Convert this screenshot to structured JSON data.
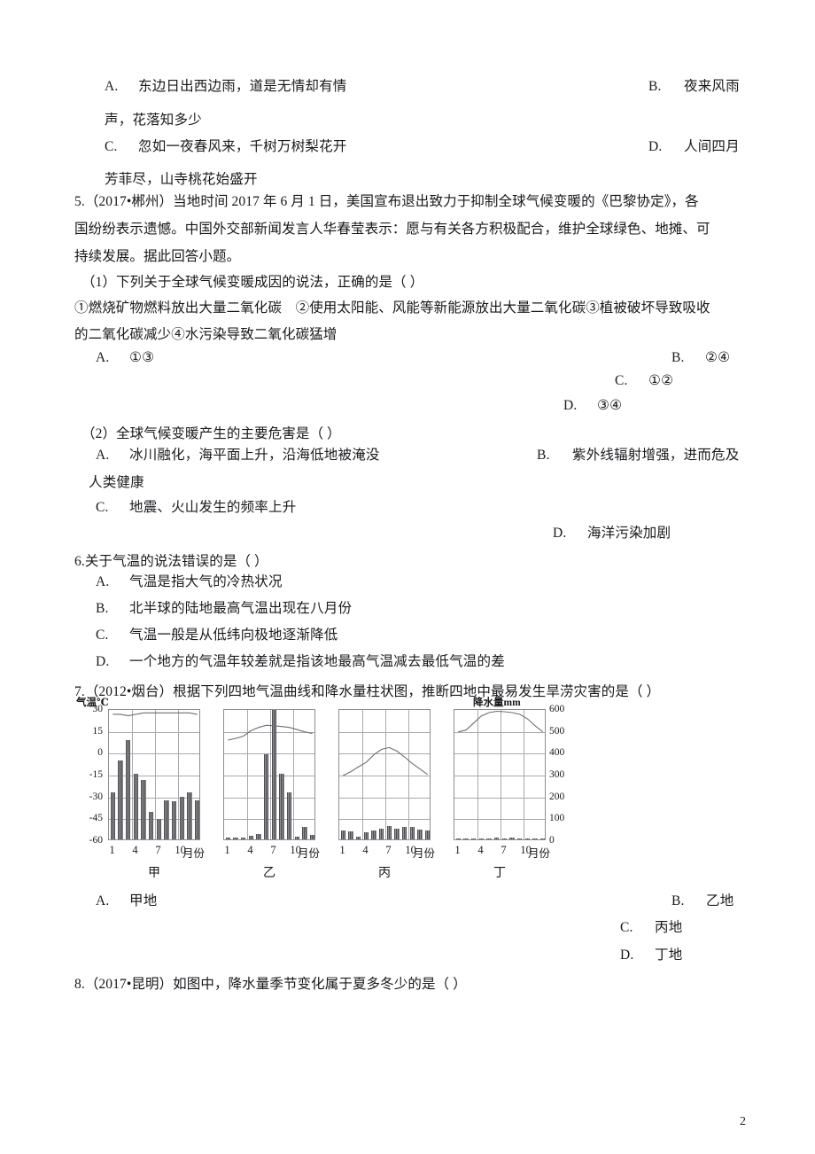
{
  "page": {
    "number": "2"
  },
  "q4_options": {
    "a_letter": "A.",
    "a_text": "东边日出西边雨，道是无情却有情",
    "b_letter": "B.",
    "b_text": "夜来风雨",
    "b_cont": "声，花落知多少",
    "c_letter": "C.",
    "c_text": "忽如一夜春风来，千树万树梨花开",
    "d_letter": "D.",
    "d_text": "人间四月",
    "d_cont": "芳菲尽，山寺桃花始盛开"
  },
  "q5": {
    "stem_l1": "5.（2017•郴州）当地时间 2017 年 6 月 1 日，美国宣布退出致力于抑制全球气候变暖的《巴黎协定》，各",
    "stem_l2": "国纷纷表示遗憾。中国外交部新闻发言人华春莹表示：愿与有关各方积极配合，维护全球绿色、地摊、可",
    "stem_l3": "持续发展。据此回答小题。",
    "sub1": {
      "stem": "（1）下列关于全球气候变暖成因的说法，正确的是（          ）",
      "detail_l1": "①燃烧矿物燃料放出大量二氧化碳　②使用太阳能、风能等新能源放出大量二氧化碳③植被破坏导致吸收",
      "detail_l2": "的二氧化碳减少④水污染导致二氧化碳猛增",
      "a_letter": "A.",
      "a_text": "①③",
      "b_letter": "B.",
      "b_text": "②④",
      "c_letter": "C.",
      "c_text": "①②",
      "d_letter": "D.",
      "d_text": "③④"
    },
    "sub2": {
      "stem": "（2）全球气候变暖产生的主要危害是（        ）",
      "a_letter": "A.",
      "a_text": "冰川融化，海平面上升，沿海低地被淹没",
      "b_letter": "B.",
      "b_text": "紫外线辐射增强，进而危及",
      "b_cont": "人类健康",
      "c_letter": "C.",
      "c_text": "地震、火山发生的频率上升",
      "d_letter": "D.",
      "d_text": "海洋污染加剧"
    }
  },
  "q6": {
    "stem": "6.关于气温的说法错误的是（     ）",
    "a_letter": "A.",
    "a_text": "气温是指大气的冷热状况",
    "b_letter": "B.",
    "b_text": "北半球的陆地最高气温出现在八月份",
    "c_letter": "C.",
    "c_text": "气温一般是从低纬向极地逐渐降低",
    "d_letter": "D.",
    "d_text": "一个地方的气温年较差就是指该地最高气温减去最低气温的差"
  },
  "q7": {
    "stem": "7.（2012•烟台）根据下列四地气温曲线和降水量柱状图，推断四地中最易发生旱涝灾害的是（     ）",
    "a_letter": "A.",
    "a_text": "甲地",
    "b_letter": "B.",
    "b_text": "乙地",
    "c_letter": "C.",
    "c_text": "丙地",
    "d_letter": "D.",
    "d_text": "丁地"
  },
  "q8": {
    "stem": "8.（2017•昆明）如图中，降水量季节变化属于夏多冬少的是（     ）"
  },
  "chart_data": [
    {
      "type": "bar",
      "name": "jia",
      "caption": "甲",
      "ylabel_left": "气温℃",
      "left_ticks": [
        "30",
        "15",
        "0",
        "-15",
        "-30",
        "-45",
        "-60"
      ],
      "ylim": [
        -60,
        30
      ],
      "xlabel_ticks": [
        "1",
        "4",
        "7",
        "10"
      ],
      "xunit": "月份",
      "categories": [
        1,
        2,
        3,
        4,
        5,
        6,
        7,
        8,
        9,
        10,
        11,
        12
      ],
      "values": [
        -28,
        -6,
        8,
        -15,
        -19,
        -41,
        -46,
        -33,
        -34,
        -31,
        -28,
        -33
      ],
      "curve": [
        27,
        27,
        26,
        27,
        28,
        28,
        28,
        28,
        28,
        28,
        28,
        27
      ],
      "grid": true
    },
    {
      "type": "bar",
      "name": "yi",
      "caption": "乙",
      "ylim": [
        0,
        600
      ],
      "xlabel_ticks": [
        "1",
        "4",
        "7",
        "10"
      ],
      "xunit": "月份",
      "categories": [
        1,
        2,
        3,
        4,
        5,
        6,
        7,
        8,
        9,
        10,
        11,
        12
      ],
      "values": [
        8,
        8,
        10,
        18,
        25,
        390,
        620,
        300,
        215,
        12,
        55,
        20
      ],
      "curve": [
        462,
        470,
        480,
        505,
        520,
        530,
        528,
        524,
        520,
        510,
        500,
        492
      ],
      "grid": true
    },
    {
      "type": "bar",
      "name": "bing",
      "caption": "丙",
      "ylim": [
        0,
        600
      ],
      "xlabel_ticks": [
        "1",
        "4",
        "7",
        "10"
      ],
      "xunit": "月份",
      "categories": [
        1,
        2,
        3,
        4,
        5,
        6,
        7,
        8,
        9,
        10,
        11,
        12
      ],
      "values": [
        42,
        36,
        14,
        34,
        40,
        48,
        62,
        50,
        58,
        55,
        45,
        40
      ],
      "curve": [
        300,
        318,
        340,
        360,
        395,
        420,
        428,
        412,
        385,
        355,
        330,
        305
      ],
      "grid": true
    },
    {
      "type": "bar",
      "name": "ding",
      "caption": "丁",
      "ylabel_right": "降水量mm",
      "right_ticks": [
        "600",
        "500",
        "400",
        "300",
        "200",
        "100",
        "0"
      ],
      "ylim": [
        0,
        600
      ],
      "xlabel_ticks": [
        "1",
        "4",
        "7",
        "10"
      ],
      "xunit": "月份",
      "categories": [
        1,
        2,
        3,
        4,
        5,
        6,
        7,
        8,
        9,
        10,
        11,
        12
      ],
      "values": [
        2,
        2,
        3,
        3,
        4,
        10,
        5,
        8,
        3,
        2,
        2,
        2
      ],
      "curve": [
        500,
        508,
        540,
        572,
        588,
        594,
        592,
        588,
        580,
        560,
        528,
        500
      ],
      "grid": true
    }
  ]
}
